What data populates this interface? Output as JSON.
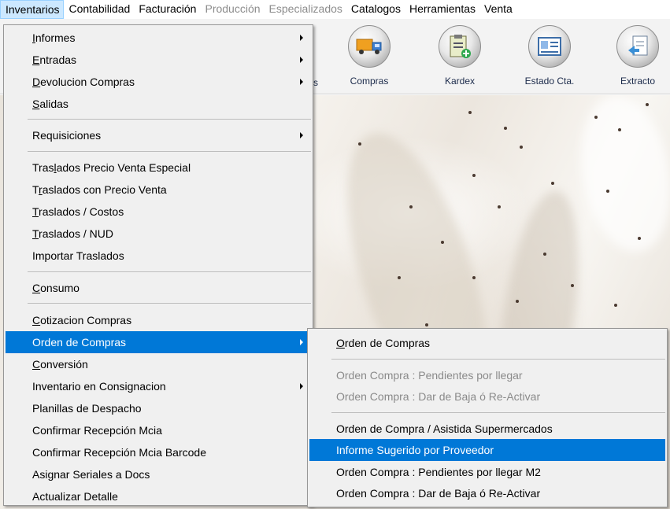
{
  "menubar": {
    "items": [
      {
        "label": "Inventarios"
      },
      {
        "label": "Contabilidad"
      },
      {
        "label": "Facturación"
      },
      {
        "label": "Producción"
      },
      {
        "label": "Especializados"
      },
      {
        "label": "Catalogos"
      },
      {
        "label": "Herramientas"
      },
      {
        "label": "Venta"
      }
    ]
  },
  "toolbar": {
    "partial_label_tail": "s",
    "buttons": [
      {
        "label": "Compras",
        "icon": "truck-icon"
      },
      {
        "label": "Kardex",
        "icon": "clipboard-add-icon"
      },
      {
        "label": "Estado Cta.",
        "icon": "id-card-icon"
      },
      {
        "label": "Extracto",
        "icon": "document-arrow-icon"
      }
    ]
  },
  "inventarios_menu": {
    "items": [
      {
        "label": "Informes",
        "accel": "I",
        "rest": "nformes",
        "submenu": true
      },
      {
        "label": "Entradas",
        "accel": "E",
        "rest": "ntradas",
        "submenu": true
      },
      {
        "label": "Devolucion Compras",
        "accel": "D",
        "rest": "evolucion Compras",
        "submenu": true
      },
      {
        "label": "Salidas",
        "accel": "S",
        "rest": "alidas",
        "submenu": false
      },
      {
        "label": "Requisiciones",
        "submenu": true
      },
      {
        "label": "Traslados  Precio Venta Especial",
        "pre": "Tras",
        "accel": "l",
        "rest": "ados  Precio Venta Especial"
      },
      {
        "label": "Traslados con Precio Venta",
        "pre": "T",
        "accel": "r",
        "rest": "aslados con Precio Venta"
      },
      {
        "label": "Traslados  / Costos",
        "accel": "T",
        "rest": "raslados  / Costos"
      },
      {
        "label": "Traslados / NUD",
        "accel": "T",
        "rest": "raslados / NUD"
      },
      {
        "label": "Importar Traslados"
      },
      {
        "label": "Consumo",
        "accel": "C",
        "rest": "onsumo"
      },
      {
        "label": "Cotizacion Compras",
        "accel": "C",
        "rest": "otizacion Compras"
      },
      {
        "label": "Orden de Compras",
        "submenu": true,
        "highlighted": true
      },
      {
        "label": "Conversión",
        "accel": "C",
        "rest": "onversión"
      },
      {
        "label": "Inventario en Consignacion",
        "submenu": true
      },
      {
        "label": "Planillas de Despacho"
      },
      {
        "label": "Confirmar Recepción Mcia"
      },
      {
        "label": "Confirmar Recepción Mcia Barcode"
      },
      {
        "label": "Asignar Seriales a Docs"
      },
      {
        "label": "Actualizar Detalle"
      }
    ]
  },
  "orden_compras_submenu": {
    "items": [
      {
        "label": "Orden de Compras",
        "accel": "O",
        "rest": "rden de Compras",
        "disabled": false
      },
      {
        "label": "Orden Compra : Pendientes  por llegar",
        "disabled": true
      },
      {
        "label": "Orden Compra : Dar de  Baja ó  Re-Activar",
        "disabled": true
      },
      {
        "label": "Orden de Compra / Asistida Supermercados",
        "disabled": false
      },
      {
        "label": "Informe Sugerido por Proveedor",
        "disabled": false,
        "highlighted": true
      },
      {
        "label": "Orden Compra : Pendientes por llegar M2",
        "disabled": false
      },
      {
        "label": "Orden Compra : Dar de  Baja ó  Re-Activar",
        "disabled": false
      }
    ]
  },
  "colors": {
    "highlight": "#0078d7",
    "menu_bg": "#f0f0f0",
    "active_menubar": "#cce8ff"
  }
}
